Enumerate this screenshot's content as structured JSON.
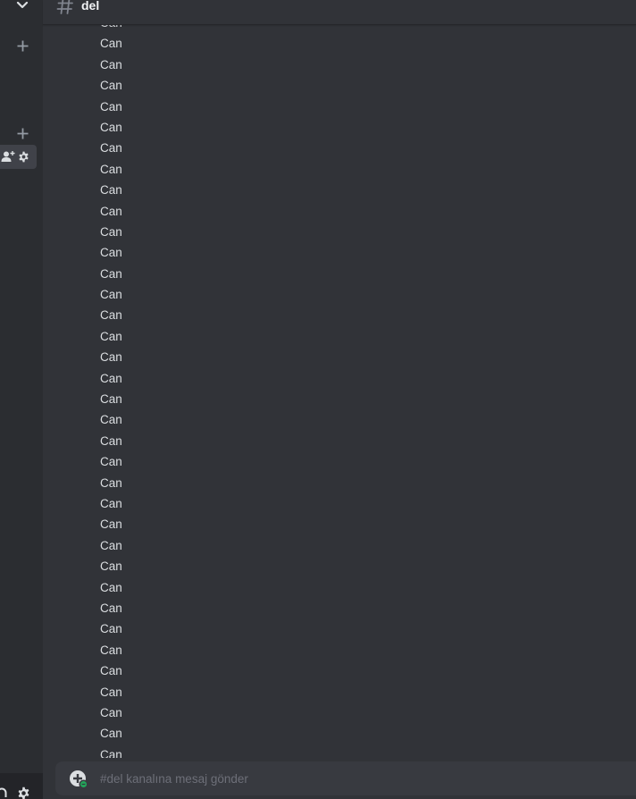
{
  "sidebar": {
    "icons": {
      "collapse": "chevron-down-icon",
      "add_top": "plus-icon",
      "add_bottom": "plus-icon",
      "invite": "add-member-icon",
      "channel_settings": "gear-icon",
      "headset": "headset-icon",
      "user_settings": "gear-icon"
    }
  },
  "header": {
    "channel_icon": "hashtag-icon",
    "channel_name": "del"
  },
  "messages": [
    "Can",
    "Can",
    "Can",
    "Can",
    "Can",
    "Can",
    "Can",
    "Can",
    "Can",
    "Can",
    "Can",
    "Can",
    "Can",
    "Can",
    "Can",
    "Can",
    "Can",
    "Can",
    "Can",
    "Can",
    "Can",
    "Can",
    "Can",
    "Can",
    "Can",
    "Can",
    "Can",
    "Can",
    "Can",
    "Can",
    "Can",
    "Can",
    "Can",
    "Can",
    "Can",
    "Can"
  ],
  "composer": {
    "placeholder": "#del kanalına mesaj gönder",
    "value": "",
    "attach_icon": "add-attachment-icon"
  },
  "colors": {
    "background": "#313338",
    "sidebar": "#2b2d31",
    "text": "#dbdee1",
    "muted": "#80848e",
    "status_green": "#23a55a"
  }
}
